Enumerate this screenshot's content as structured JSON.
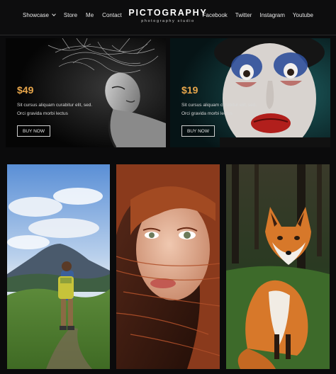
{
  "header": {
    "brand_title": "PICTOGRAPHY",
    "brand_subtitle": "photography studio",
    "nav_left": [
      "Showcase",
      "Store",
      "Me",
      "Contact"
    ],
    "nav_right": [
      "Facebook",
      "Twitter",
      "Instagram",
      "Youtube"
    ]
  },
  "products": [
    {
      "price": "$49",
      "desc_line1": "Sit cursus aliquam curabitur elit, sed.",
      "desc_line2": "Orci gravida morbi lectus",
      "button": "BUY NOW"
    },
    {
      "price": "$19",
      "desc_line1": "Sit cursus aliquam curabitur elit, sed.",
      "desc_line2": "Orci gravida morbi lectus",
      "button": "BUY NOW"
    }
  ],
  "colors": {
    "price": "#e8a64b",
    "background": "#0b0b0c"
  }
}
